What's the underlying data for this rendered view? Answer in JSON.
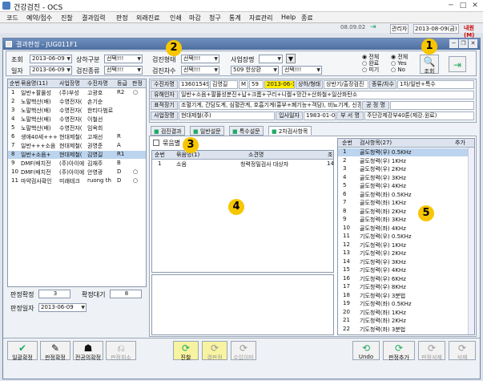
{
  "app": {
    "title": "건강검진 - OCS"
  },
  "menu": [
    "코드",
    "예약/접수",
    "진찰",
    "결과입력",
    "판정",
    "외래진료",
    "인쇄",
    "마감",
    "청구",
    "통계",
    "자료관리",
    "Help",
    "종료"
  ],
  "topbar": {
    "date": "08.09.02",
    "user_label": "관리자",
    "user_date": "2013-08-09(금)",
    "status": "내원(M)"
  },
  "inner": {
    "title": "결과판정 - JUG011F1"
  },
  "search": {
    "label_inquiry": "조회",
    "inquiry_date": "2013-06-09",
    "label_half": "상하구분",
    "half_val": "선택!!!",
    "label_exam_type": "검진형태",
    "exam_type_val": "선택!!!",
    "label_company": "사업장명",
    "company_val": "",
    "label_date": "일자",
    "date_val": "2013-06-09",
    "label_exam_kind": "검진종류",
    "exam_kind_val": "선택!!!",
    "label_round": "검진차수",
    "round_val": "선택!!!",
    "site_val": "509 한상환",
    "site2_val": "선택!!!",
    "radio1": [
      "전체",
      "완료",
      "미기"
    ],
    "radio2": [
      "전체",
      "Yes",
      "No"
    ],
    "search_btn": "조회"
  },
  "patient_list": {
    "headers": [
      "순번",
      "묶음명(11)",
      "사업장명",
      "수진자명",
      "등급",
      "판정"
    ],
    "rows": [
      [
        "1",
        "일반+팔몰성",
        "(주)부성",
        "고광호",
        "R2",
        "○"
      ],
      [
        "2",
        "노말핵산(배)",
        "수영전자(",
        "손기순",
        "",
        ""
      ],
      [
        "3",
        "노말핵산(배)",
        "수영전자(",
        "한티다범로",
        "",
        ""
      ],
      [
        "4",
        "노말핵산(배)",
        "수영전자(",
        "이철선",
        "",
        ""
      ],
      [
        "5",
        "노말핵산(배)",
        "수영전자(",
        "임옥희",
        "",
        ""
      ],
      [
        "6",
        "생애40세+++",
        "현대제철(",
        "고재선",
        "R",
        ""
      ],
      [
        "7",
        "일반+++소음",
        "현대제철(",
        "권영준",
        "A",
        ""
      ],
      [
        "8",
        "일반+소음+",
        "현대제철(",
        "김영길",
        "R1",
        ""
      ],
      [
        "9",
        "DMF(배치전",
        "(주)아이에",
        "김재주",
        "B",
        ""
      ],
      [
        "10",
        "DMF(배치전",
        "(주)아이에",
        "안영광",
        "D",
        "○"
      ],
      [
        "11",
        "마약검사확인",
        "미래테크",
        "ruong th",
        "D",
        "○"
      ]
    ],
    "selected": 7,
    "label_confirmed": "판정확정",
    "confirmed_val": "3",
    "label_waiting": "확정대기",
    "waiting_val": "8",
    "label_judge_date": "판정일자",
    "judge_date_val": "2013-06-09"
  },
  "patient_info": {
    "l1": "수진자명",
    "no": "13601549",
    "name": "김영길",
    "sex": "M",
    "age": "59",
    "date": "2013-06-10",
    "l_status": "상하/형태",
    "status": "상반기/출장검진",
    "l_kind": "종류/차수",
    "kind": "1차/일반+특수",
    "l2": "유해인자",
    "factors": "일반+소음+팔몰성분진+납+크롬+구리+니켈+망간+산화철+일산화탄소",
    "l3": "표적장기",
    "organs": "조혈기계, 간담도계, 심혈관계, 호흡기계(흉부+폐기능+객담), 비뇨기계, 신경계",
    "l_process": "공 정 명",
    "process": "",
    "l4": "사업장명",
    "company": "현대제철(주)",
    "l_join": "입사일자",
    "join": "1983-01-01",
    "l_dept": "부 서 명",
    "dept": "주단강제강부40톤(제강.원료)"
  },
  "tabs": [
    "검진결과",
    "일반설문",
    "특수설문",
    "2차검사항목"
  ],
  "bundle": {
    "check_label": "묶음별",
    "headers": [
      "순번",
      "묶음명(1)",
      "소견명",
      "조"
    ],
    "rows": [
      [
        "1",
        "소음",
        "청력정밀검사 대상자",
        "14"
      ]
    ]
  },
  "items": {
    "headers": [
      "순번",
      "검사항목(27)",
      "추가"
    ],
    "rows": [
      [
        "1",
        "골도청력(우) 0.5KHz"
      ],
      [
        "2",
        "골도청력(우) 1KHz"
      ],
      [
        "3",
        "골도청력(우) 2KHz"
      ],
      [
        "4",
        "골도청력(우) 3KHz"
      ],
      [
        "5",
        "골도청력(우) 4KHz"
      ],
      [
        "6",
        "골도청력(좌) 0.5KHz"
      ],
      [
        "7",
        "골도청력(좌) 1KHz"
      ],
      [
        "8",
        "골도청력(좌) 2KHz"
      ],
      [
        "9",
        "골도청력(좌) 3KHz"
      ],
      [
        "10",
        "골도청력(좌) 4KHz"
      ],
      [
        "11",
        "기도청력(우) 0.5KHz"
      ],
      [
        "12",
        "기도청력(우) 1KHz"
      ],
      [
        "13",
        "기도청력(우) 2KHz"
      ],
      [
        "14",
        "기도청력(우) 3KHz"
      ],
      [
        "15",
        "기도청력(우) 4KHz"
      ],
      [
        "16",
        "기도청력(우) 6KHz"
      ],
      [
        "17",
        "기도청력(우) 8KHz"
      ],
      [
        "18",
        "기도청력(우) 3분법"
      ],
      [
        "19",
        "기도청력(좌) 0.5KHz"
      ],
      [
        "20",
        "기도청력(좌) 1KHz"
      ],
      [
        "21",
        "기도청력(좌) 2KHz"
      ],
      [
        "22",
        "기도청력(좌) 3분법"
      ]
    ]
  },
  "bottom": {
    "b1": "일괄확정",
    "b2": "판정확정",
    "b3": "전공의확정",
    "b4": "판정취소",
    "b5": "진찰",
    "b6": "결판정",
    "b7": "수입이미",
    "b8": "Undo",
    "b9": "판정추가",
    "b10": "판정삭제",
    "b11": "삭제"
  },
  "badges": [
    "1",
    "2",
    "3",
    "4",
    "5"
  ]
}
